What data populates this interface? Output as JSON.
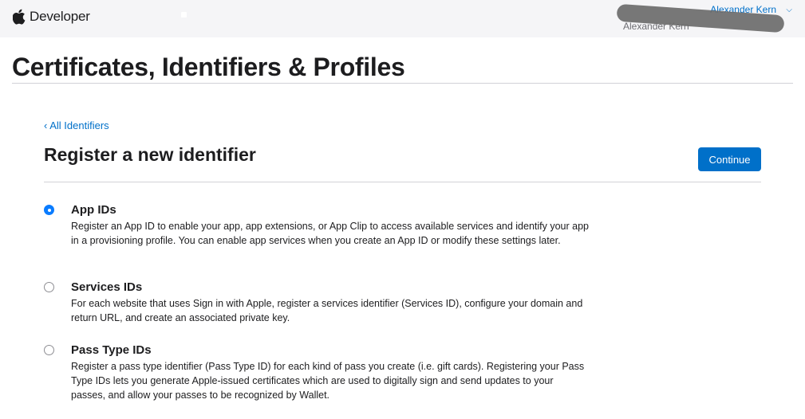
{
  "header": {
    "brand": "Developer",
    "account_name": "Alexander Kern",
    "account_team": "Alexander Kern"
  },
  "page": {
    "title": "Certificates, Identifiers & Profiles"
  },
  "main": {
    "back_link": "‹ All Identifiers",
    "section_title": "Register a new identifier",
    "continue_label": "Continue",
    "options": [
      {
        "title": "App IDs",
        "description": "Register an App ID to enable your app, app extensions, or App Clip to access available services and identify your app in a provisioning profile. You can enable app services when you create an App ID or modify these settings later.",
        "selected": true
      },
      {
        "title": "Services IDs",
        "description": "For each website that uses Sign in with Apple, register a services identifier (Services ID), configure your domain and return URL, and create an associated private key.",
        "selected": false
      },
      {
        "title": "Pass Type IDs",
        "description": "Register a pass type identifier (Pass Type ID) for each kind of pass you create (i.e. gift cards). Registering your Pass Type IDs lets you generate Apple-issued certificates which are used to digitally sign and send updates to your passes, and allow your passes to be recognized by Wallet.",
        "selected": false
      }
    ]
  },
  "icons": {
    "brand_logo": "apple-logo-icon",
    "account_menu": "chevron-down-icon"
  },
  "colors": {
    "accent": "#0070c9",
    "radio_selected": "#0a7cff",
    "topbar_bg": "#f5f5f7"
  }
}
